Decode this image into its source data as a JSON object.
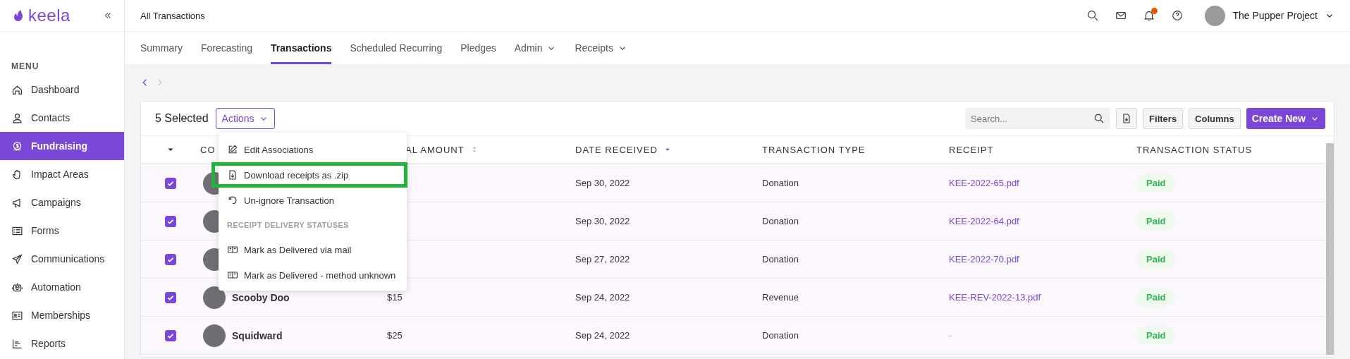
{
  "sidebar": {
    "logo": "keela",
    "menu_heading": "MENU",
    "items": [
      {
        "label": "Dashboard",
        "selected": false
      },
      {
        "label": "Contacts",
        "selected": false
      },
      {
        "label": "Fundraising",
        "selected": true
      },
      {
        "label": "Impact Areas",
        "selected": false
      },
      {
        "label": "Campaigns",
        "selected": false
      },
      {
        "label": "Forms",
        "selected": false
      },
      {
        "label": "Communications",
        "selected": false
      },
      {
        "label": "Automation",
        "selected": false
      },
      {
        "label": "Memberships",
        "selected": false
      },
      {
        "label": "Reports",
        "selected": false
      }
    ]
  },
  "header": {
    "title": "All Transactions",
    "has_notification": true,
    "account": "The Pupper Project"
  },
  "tabs": [
    {
      "label": "Summary",
      "selected": false,
      "has_menu": false
    },
    {
      "label": "Forecasting",
      "selected": false,
      "has_menu": false
    },
    {
      "label": "Transactions",
      "selected": true,
      "has_menu": false
    },
    {
      "label": "Scheduled Recurring",
      "selected": false,
      "has_menu": false
    },
    {
      "label": "Pledges",
      "selected": false,
      "has_menu": false
    },
    {
      "label": "Admin",
      "selected": false,
      "has_menu": true
    },
    {
      "label": "Receipts",
      "selected": false,
      "has_menu": true
    }
  ],
  "pager": {
    "prev_disabled": false,
    "next_disabled": true
  },
  "toolbar": {
    "selection": "5 Selected",
    "actions": "Actions",
    "search_placeholder": "Search...",
    "filters": "Filters",
    "columns": "Columns",
    "create": "Create New"
  },
  "table": {
    "columns": [
      {
        "label": "CO"
      },
      {
        "label": "AL AMOUNT",
        "sortable": true,
        "sorted": false
      },
      {
        "label": "DATE RECEIVED",
        "sorted": true
      },
      {
        "label": "TRANSACTION TYPE",
        "sortable": false,
        "sorted": false
      },
      {
        "label": "RECEIPT",
        "sortable": false,
        "sorted": false
      },
      {
        "label": "TRANSACTION STATUS",
        "sortable": false,
        "sorted": false
      }
    ],
    "rows": [
      {
        "checked": true,
        "date": "Sep 30, 2022",
        "type": "Donation",
        "receipt": "KEE-2022-65.pdf",
        "status": "Paid"
      },
      {
        "checked": true,
        "date": "Sep 30, 2022",
        "type": "Donation",
        "receipt": "KEE-2022-64.pdf",
        "status": "Paid"
      },
      {
        "checked": true,
        "date": "Sep 27, 2022",
        "type": "Donation",
        "receipt": "KEE-2022-70.pdf",
        "status": "Paid"
      },
      {
        "checked": true,
        "contact": "Scooby Doo",
        "amount": "$15",
        "date": "Sep 24, 2022",
        "type": "Revenue",
        "receipt": "KEE-REV-2022-13.pdf",
        "status": "Paid"
      },
      {
        "checked": true,
        "contact": "Squidward",
        "amount": "$25",
        "date": "Sep 24, 2022",
        "type": "Donation",
        "receipt": "-",
        "status": "Paid"
      }
    ]
  },
  "actions_menu": {
    "items": [
      {
        "kind": "action",
        "label": "Edit Associations",
        "highlighted": false
      },
      {
        "kind": "action",
        "label": "Download receipts as .zip",
        "highlighted": true
      },
      {
        "kind": "action",
        "label": "Un-ignore Transaction",
        "highlighted": false
      },
      {
        "kind": "heading",
        "label": "RECEIPT DELIVERY STATUSES"
      },
      {
        "kind": "action",
        "label": "Mark as Delivered via mail",
        "highlighted": false
      },
      {
        "kind": "action",
        "label": "Mark as Delivered - method unknown",
        "highlighted": false
      }
    ]
  }
}
